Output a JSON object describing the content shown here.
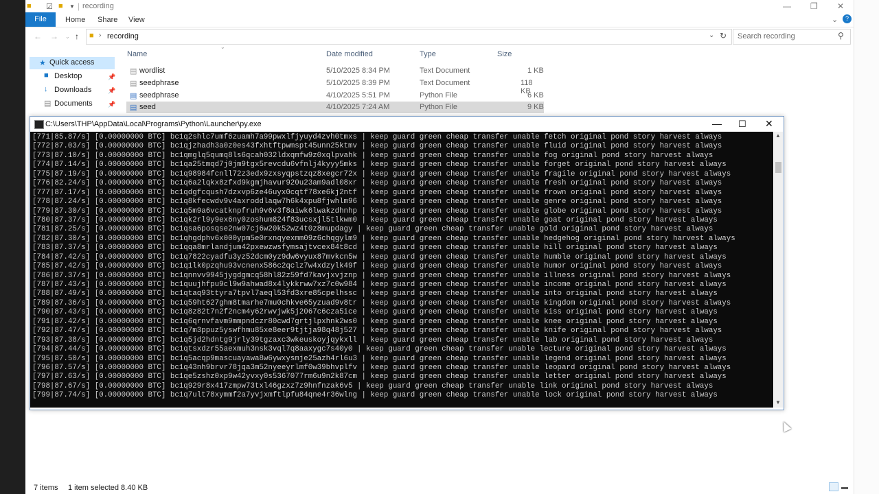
{
  "explorer": {
    "title": "recording",
    "ribbon_tabs": [
      "File",
      "Home",
      "Share",
      "View"
    ],
    "address": "recording",
    "search_placeholder": "Search recording",
    "nav": {
      "quick_access": "Quick access",
      "items": [
        "Desktop",
        "Downloads",
        "Documents"
      ]
    },
    "columns": [
      "Name",
      "Date modified",
      "Type",
      "Size"
    ],
    "files": [
      {
        "name": "wordlist",
        "date": "5/10/2025 8:34 PM",
        "type": "Text Document",
        "size": "1 KB"
      },
      {
        "name": "seedphrase",
        "date": "5/10/2025 8:39 PM",
        "type": "Text Document",
        "size": "118 KB"
      },
      {
        "name": "seedphrase",
        "date": "4/10/2025 5:51 PM",
        "type": "Python File",
        "size": "6 KB"
      },
      {
        "name": "seed",
        "date": "4/10/2025 7:24 AM",
        "type": "Python File",
        "size": "9 KB"
      }
    ],
    "status": {
      "items": "7 items",
      "selection": "1 item selected  8.40 KB"
    }
  },
  "console": {
    "title": "C:\\Users\\THP\\AppData\\Local\\Programs\\Python\\Launcher\\py.exe",
    "lines": [
      "[771|85.87/s] [0.00000000 BTC] bc1q2shlc7umf6zuamh7a99pwxlfjyuyd4zvh0tmxs | keep guard green cheap transfer unable fetch original pond story harvest always",
      "[772|87.03/s] [0.00000000 BTC] bc1qjzhadh3a0z0es43fxhtftpwmspt45unn25ktmv | keep guard green cheap transfer unable fluid original pond story harvest always",
      "[773|87.10/s] [0.00000000 BTC] bc1qmglq5qumq8ls6qcah032ldxqmfw9z0xqlpvahk | keep guard green cheap transfer unable fog original pond story harvest always",
      "[774|87.14/s] [0.00000000 BTC] bc1qa25tmqd7j0jm9tgx5revcdu6vfnlj4kyyy5mks | keep guard green cheap transfer unable forget original pond story harvest always",
      "[775|87.19/s] [0.00000000 BTC] bc1q98984fcnll72z3edx9zxsyqpstzqz8xegcr72x | keep guard green cheap transfer unable fragile original pond story harvest always",
      "[776|82.24/s] [0.00000000 BTC] bc1q6a2lqkx8zfxd9kgmjhavur920u23am9adl08xr | keep guard green cheap transfer unable fresh original pond story harvest always",
      "[777|87.17/s] [0.00000000 BTC] bc1qdgfcqush7dzxvp6ze46uyx0cqtf78xe6kj2ntf | keep guard green cheap transfer unable frown original pond story harvest always",
      "[778|87.24/s] [0.00000000 BTC] bc1q8kfecwdv9v4axroddlaqw7h6k4xpu8fjwhlm96 | keep guard green cheap transfer unable genre original pond story harvest always",
      "[779|87.30/s] [0.00000000 BTC] bc1q5m9a6vcatknpfruh9v6v3f8aiwk6lwakzdhnhp | keep guard green cheap transfer unable globe original pond story harvest always",
      "[780|87.37/s] [0.00000000 BTC] bc1qk2rl9y9ex6ny0zoshum824f83ucsxjl5tlkwm0 | keep guard green cheap transfer unable goat original pond story harvest always",
      "[781|87.25/s] [0.00000000 BTC] bc1qsa6posqse2nw07cj6w20k52wz4t0z8mupdagy | keep guard green cheap transfer unable gold original pond story harvest always",
      "[782|87.30/s] [0.00000000 BTC] bc1qhgdphv6x000ypm5e0rxnqyexmm09z6chqgylm9 | keep guard green cheap transfer unable hedgehog original pond story harvest always",
      "[783|87.37/s] [0.00000000 BTC] bc1qqa8mrlandjum42pxewzwsfymsajtvcex84t8cd | keep guard green cheap transfer unable hill original pond story harvest always",
      "[784|87.42/s] [0.00000000 BTC] bc1q7822cyadfu3yz52dcm0yz9dw6vyux87mvkcn5w | keep guard green cheap transfer unable humble original pond story harvest always",
      "[785|87.42/s] [0.00000000 BTC] bc1q1lk0pzqhu93vcnenx586c2qclz7w4xdzylk49f | keep guard green cheap transfer unable humor original pond story harvest always",
      "[786|87.37/s] [0.00000000 BTC] bc1qnnvv9945jygdgmcq58hl82z59fd7kavjxvjznp | keep guard green cheap transfer unable illness original pond story harvest always",
      "[787|87.43/s] [0.00000000 BTC] bc1quujhfpu9cl9w9ahwad8x4lykkrww7xz7c0w984 | keep guard green cheap transfer unable income original pond story harvest always",
      "[788|87.49/s] [0.00000000 BTC] bc1qtaq93ttyra7tpvl7aeql53fd3xre85cpelhssc | keep guard green cheap transfer unable into original pond story harvest always",
      "[789|87.36/s] [0.00000000 BTC] bc1q59ht627ghm8tmarhe7mu0chkve65yzuad9v8tr | keep guard green cheap transfer unable kingdom original pond story harvest always",
      "[790|87.43/s] [0.00000000 BTC] bc1q8z82t7n2f2ncm4y62rwvjwk5j2067c6cza5ice | keep guard green cheap transfer unable kiss original pond story harvest always",
      "[791|87.42/s] [0.00000000 BTC] bc1q6qrnvfavm9mmpndczr80cwd7grtjlpxhnk2ws0 | keep guard green cheap transfer unable knee original pond story harvest always",
      "[792|87.47/s] [0.00000000 BTC] bc1q7m3ppuz5yswfhmu85xe8eer9tjtja98q48j527 | keep guard green cheap transfer unable knife original pond story harvest always",
      "[793|87.38/s] [0.00000000 BTC] bc1q5jd2hdntg9jrly39tgzaxc3wkeuskoyjqykxll | keep guard green cheap transfer unable lab original pond story harvest always",
      "[794|87.44/s] [0.00000000 BTC] bc1qtsxdzr55aexmuh3nsk3vql7q8aaxygc7s40y0 | keep guard green cheap transfer unable lecture original pond story harvest always",
      "[795|87.50/s] [0.00000000 BTC] bc1q5acqp9mascuayawa8w6ywxysmje25azh4rl6u3 | keep guard green cheap transfer unable legend original pond story harvest always",
      "[796|87.57/s] [0.00000000 BTC] bc1q43nh9brvr78jqa3m52nyeeyrlmf0w39bhvplfv | keep guard green cheap transfer unable leopard original pond story harvest always",
      "[797|87.63/s] [0.00000000 BTC] bc1qe5zshz0xp9w42yvxy0s5367077rm6u9n2k87cm | keep guard green cheap transfer unable letter original pond story harvest always",
      "[798|87.67/s] [0.00000000 BTC] bc1q929r8x417zmpw73txl46gzxz7z9hnfnzak6v5 | keep guard green cheap transfer unable link original pond story harvest always",
      "[799|87.74/s] [0.00000000 BTC] bc1q7ult78xymmf2a7yvjxmftlpfu84qne4r36wlng | keep guard green cheap transfer unable lock original pond story harvest always"
    ]
  }
}
